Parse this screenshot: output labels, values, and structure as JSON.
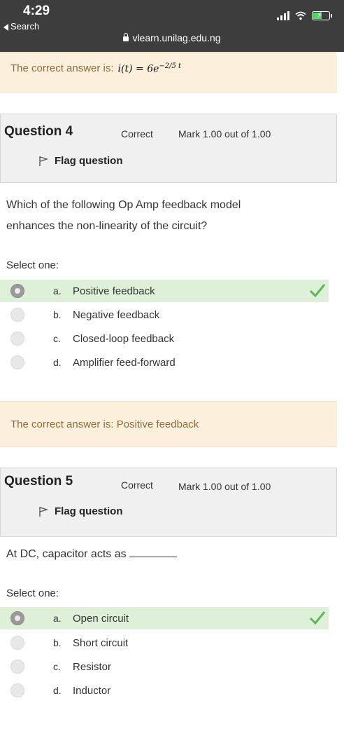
{
  "status": {
    "time": "4:29",
    "back_label": "Search",
    "url": "vlearn.unilag.edu.ng"
  },
  "top_feedback": {
    "prefix": "The correct answer is:",
    "formula_main": "i(t) = 6e",
    "formula_exp": "−2/5 t"
  },
  "questions": [
    {
      "number_label": "Question",
      "number": "4",
      "state": "Correct",
      "mark": "Mark 1.00 out of 1.00",
      "flag_label": "Flag question",
      "text_line1": "Which of the following Op Amp feedback model",
      "text_line2": "enhances the non-linearity of the circuit?",
      "select_label": "Select one:",
      "options": [
        {
          "letter": "a.",
          "text": "Positive feedback"
        },
        {
          "letter": "b.",
          "text": "Negative feedback"
        },
        {
          "letter": "c.",
          "text": "Closed-loop feedback"
        },
        {
          "letter": "d.",
          "text": "Amplifier feed-forward"
        }
      ],
      "feedback": "The correct answer is: Positive feedback"
    },
    {
      "number_label": "Question",
      "number": "5",
      "state": "Correct",
      "mark": "Mark 1.00 out of 1.00",
      "flag_label": "Flag question",
      "text_line1": "At DC, capacitor acts as",
      "select_label": "Select one:",
      "options": [
        {
          "letter": "a.",
          "text": "Open circuit"
        },
        {
          "letter": "b.",
          "text": "Short circuit"
        },
        {
          "letter": "c.",
          "text": "Resistor"
        },
        {
          "letter": "d.",
          "text": "Inductor"
        }
      ]
    }
  ],
  "colors": {
    "correct_bg": "#dff0d8",
    "feedback_bg": "#fcefdc",
    "feedback_text": "#8a6d3b",
    "check": "#5cb85c"
  }
}
